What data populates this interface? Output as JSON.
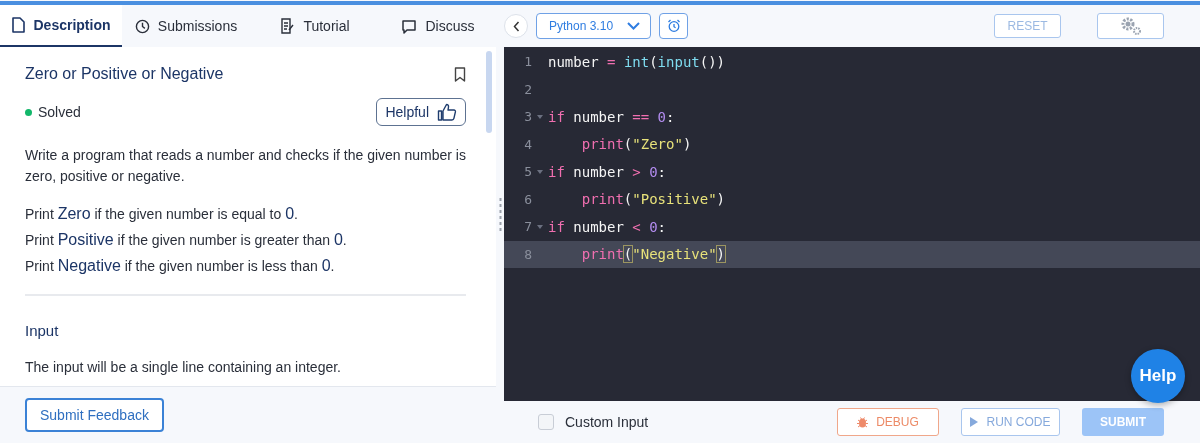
{
  "tabs": [
    {
      "label": "Description",
      "selected": true
    },
    {
      "label": "Submissions",
      "selected": false
    },
    {
      "label": "Tutorial",
      "selected": false
    },
    {
      "label": "Discuss",
      "selected": false
    }
  ],
  "problem": {
    "title": "Zero or Positive or Negative",
    "status": "Solved",
    "solved": true,
    "helpful_label": "Helpful",
    "paragraphs": [
      "Write a program that reads a number and checks if the given number is zero, positive or negative."
    ],
    "rules": [
      "Print **Zero** if the given number is equal to **0**.",
      "Print **Positive** if the given number is greater than **0**.",
      "Print **Negative** if the given number is less than **0**."
    ],
    "input_heading": "Input",
    "input_text": "The input will be a single line containing an integer."
  },
  "feedback_button": "Submit Feedback",
  "editor": {
    "language": "Python 3.10",
    "reset_label": "RESET",
    "lines": [
      {
        "number": "1",
        "foldable": false,
        "active": false,
        "tokens": [
          {
            "kind": "plain",
            "text": "number "
          },
          {
            "kind": "op",
            "text": "="
          },
          {
            "kind": "builtin",
            "text": " int"
          },
          {
            "kind": "plain",
            "text": "("
          },
          {
            "kind": "builtin",
            "text": "input"
          },
          {
            "kind": "plain",
            "text": "())"
          }
        ]
      },
      {
        "number": "2",
        "foldable": false,
        "active": false
      },
      {
        "number": "3",
        "foldable": true,
        "active": false,
        "tokens": [
          {
            "kind": "keyword",
            "text": "if"
          },
          {
            "kind": "plain",
            "text": " number "
          },
          {
            "kind": "op",
            "text": "=="
          },
          {
            "kind": "num",
            "text": " 0"
          },
          {
            "kind": "plain",
            "text": ":"
          }
        ]
      },
      {
        "number": "4",
        "foldable": false,
        "active": false,
        "tokens": [
          {
            "kind": "keyword",
            "text": "    print"
          },
          {
            "kind": "plain",
            "text": "("
          },
          {
            "kind": "str",
            "text": "\"Zero\""
          },
          {
            "kind": "plain",
            "text": ")"
          }
        ]
      },
      {
        "number": "5",
        "foldable": true,
        "active": false,
        "tokens": [
          {
            "kind": "keyword",
            "text": "if"
          },
          {
            "kind": "plain",
            "text": " number "
          },
          {
            "kind": "op",
            "text": ">"
          },
          {
            "kind": "num",
            "text": " 0"
          },
          {
            "kind": "plain",
            "text": ":"
          }
        ]
      },
      {
        "number": "6",
        "foldable": false,
        "active": false,
        "tokens": [
          {
            "kind": "keyword",
            "text": "    print"
          },
          {
            "kind": "plain",
            "text": "("
          },
          {
            "kind": "str",
            "text": "\"Positive\""
          },
          {
            "kind": "plain",
            "text": ")"
          }
        ]
      },
      {
        "number": "7",
        "foldable": true,
        "active": false,
        "tokens": [
          {
            "kind": "keyword",
            "text": "if"
          },
          {
            "kind": "plain",
            "text": " number "
          },
          {
            "kind": "op",
            "text": "<"
          },
          {
            "kind": "num",
            "text": " 0"
          },
          {
            "kind": "plain",
            "text": ":"
          }
        ]
      },
      {
        "number": "8",
        "foldable": false,
        "active": true,
        "tokens": [
          {
            "kind": "keyword",
            "text": "    print"
          },
          {
            "kind": "match",
            "text": "("
          },
          {
            "kind": "str",
            "text": "\"Negative\""
          },
          {
            "kind": "match",
            "text": ")"
          }
        ]
      }
    ]
  },
  "custom_input": {
    "label": "Custom Input",
    "checked": false
  },
  "actions": [
    {
      "label": "DEBUG",
      "kind": "debug"
    },
    {
      "label": "RUN CODE",
      "kind": "run"
    },
    {
      "label": "SUBMIT",
      "kind": "submit"
    }
  ],
  "help_label": "Help"
}
